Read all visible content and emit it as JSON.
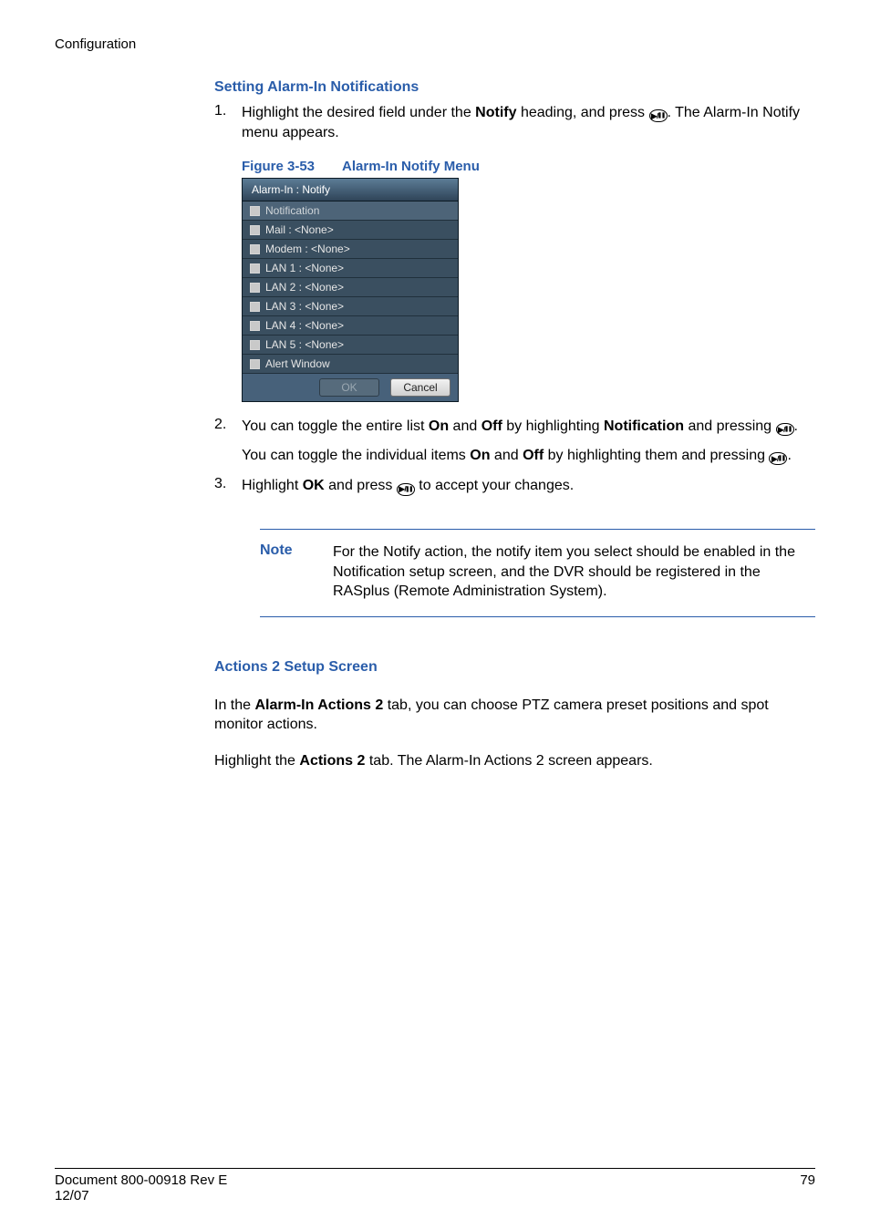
{
  "header_left": "Configuration",
  "section1_heading": "Setting Alarm-In Notifications",
  "step1_num": "1.",
  "step1_a": "Highlight the desired field under the ",
  "step1_b_bold": "Notify",
  "step1_c": " heading, and press ",
  "step1_d": ". The Alarm-In Notify menu appears.",
  "figcap_a": "Figure 3-53",
  "figcap_b": "Alarm-In Notify Menu",
  "menu": {
    "title": "Alarm-In : Notify",
    "rows": [
      "Notification",
      "Mail : <None>",
      "Modem : <None>",
      "LAN 1 : <None>",
      "LAN 2 : <None>",
      "LAN 3 : <None>",
      "LAN 4 : <None>",
      "LAN 5 : <None>",
      "Alert Window"
    ],
    "ok": "OK",
    "cancel": "Cancel"
  },
  "step2_num": "2.",
  "step2_a": "You can toggle the entire list ",
  "step2_b": "On",
  "step2_c": " and ",
  "step2_d": "Off",
  "step2_e": " by highlighting ",
  "step2_f": "Notification",
  "step2_g": " and pressing ",
  "step2_h": ".",
  "step2_sub_a": "You can toggle the individual items ",
  "step2_sub_b": "On",
  "step2_sub_c": " and ",
  "step2_sub_d": "Off",
  "step2_sub_e": " by highlighting them and pressing ",
  "step2_sub_f": ".",
  "step3_num": "3.",
  "step3_a": "Highlight ",
  "step3_b": "OK",
  "step3_c": " and press ",
  "step3_d": " to accept your changes.",
  "note_label": "Note",
  "note_text": "For the Notify action, the notify item you select should be enabled in the Notification setup screen, and the DVR should be registered in the RASplus (Remote Administration System).",
  "section2_heading": "Actions 2 Setup Screen",
  "para1_a": "In the ",
  "para1_b": "Alarm-In Actions 2",
  "para1_c": " tab, you can choose PTZ camera preset positions and spot monitor actions.",
  "para2_a": "Highlight the ",
  "para2_b": "Actions 2",
  "para2_c": " tab. The Alarm-In Actions 2 screen appears.",
  "footer_left_1": "Document 800-00918 Rev E",
  "footer_left_2": "12/07",
  "footer_right": "79"
}
